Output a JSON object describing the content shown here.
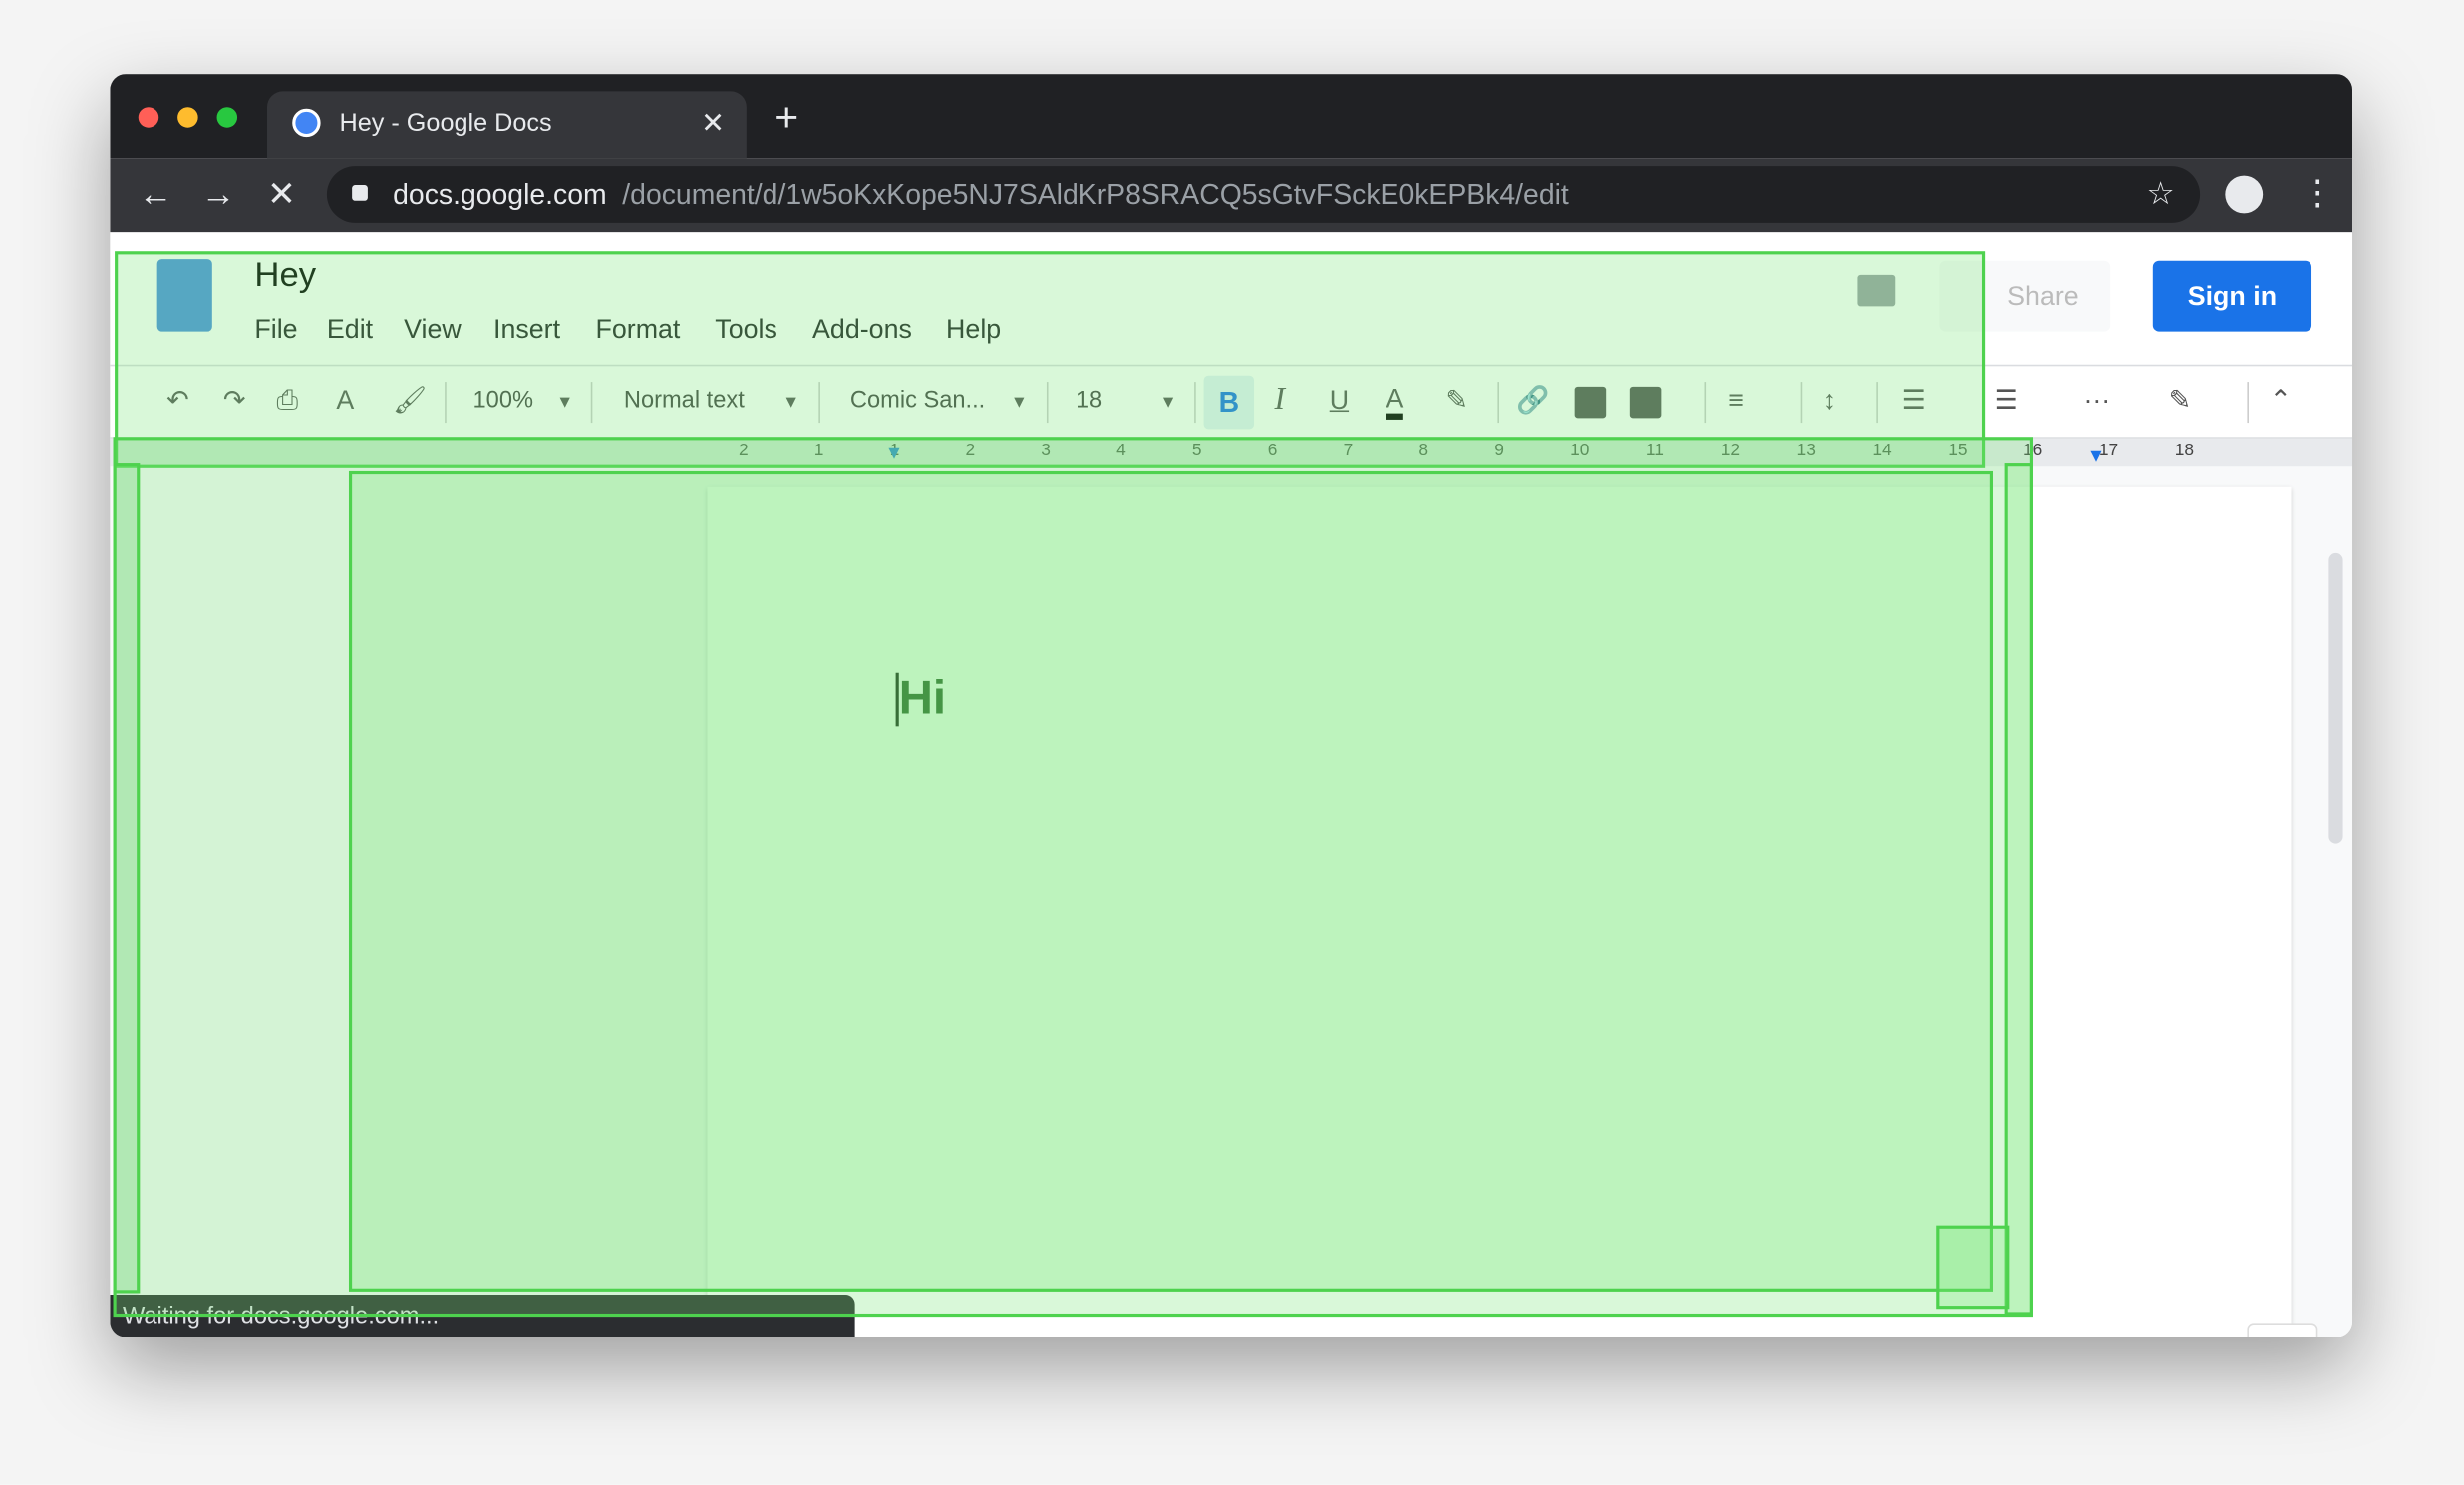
{
  "browser": {
    "tab_title": "Hey - Google Docs",
    "url_host": "docs.google.com",
    "url_path": "/document/d/1w5oKxKope5NJ7SAldKrP8SRACQ5sGtvFSckE0kEPBk4/edit",
    "status": "Waiting for docs.google.com..."
  },
  "doc": {
    "title": "Hey",
    "menu": [
      "File",
      "Edit",
      "View",
      "Insert",
      "Format",
      "Tools",
      "Add-ons",
      "Help"
    ],
    "share": "Share",
    "sign_in": "Sign in",
    "body_text": "Hi"
  },
  "toolbar": {
    "zoom": "100%",
    "style": "Normal text",
    "font": "Comic San...",
    "size": "18"
  },
  "ruler": {
    "ticks": [
      "2",
      "1",
      "1",
      "2",
      "3",
      "4",
      "5",
      "6",
      "7",
      "8",
      "9",
      "10",
      "11",
      "12",
      "13",
      "14",
      "15",
      "16",
      "17",
      "18"
    ]
  },
  "colors": {
    "accent": "#1a73e8",
    "chrome_dark": "#202124",
    "overlay": "#4ed24e"
  }
}
